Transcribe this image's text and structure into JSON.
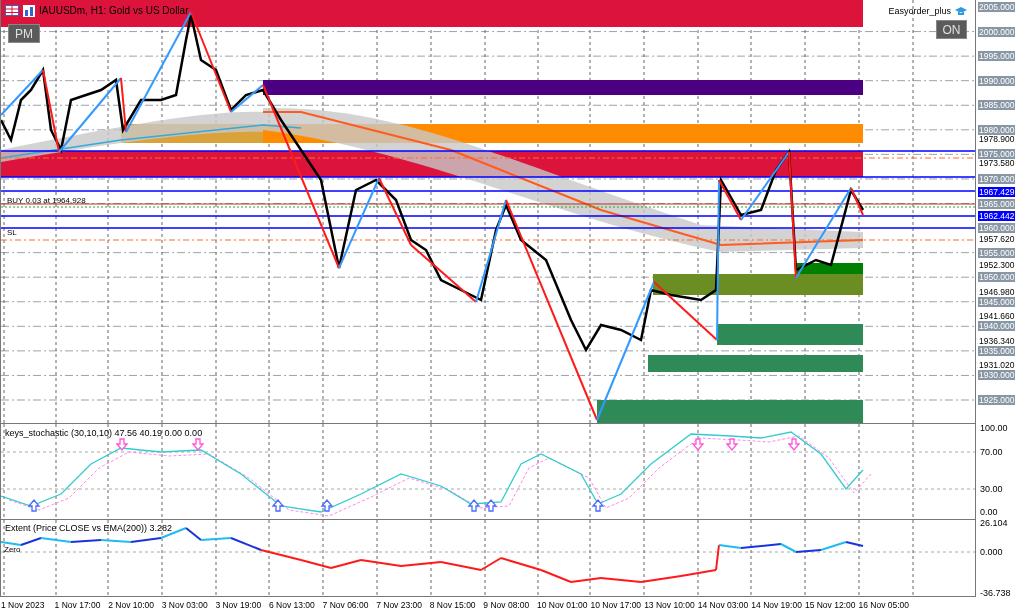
{
  "chart": {
    "title": "IAUUSDm, H1: Gold vs US Dollar",
    "left_button": "PM",
    "right_button": "ON",
    "expert": "Easyorder_plus",
    "trade_label": "BUY 0.03 at 1964.928",
    "sl_label": "SL"
  },
  "price_axis": [
    {
      "kind": "grid",
      "text": "2005.000"
    },
    {
      "kind": "grid",
      "text": "2000.000"
    },
    {
      "kind": "grid",
      "text": "1995.000"
    },
    {
      "kind": "grid",
      "text": "1990.000"
    },
    {
      "kind": "grid",
      "text": "1985.000"
    },
    {
      "kind": "grid",
      "text": "1980.000"
    },
    {
      "kind": "tick",
      "text": "1978.900"
    },
    {
      "kind": "grid",
      "text": "1975.000"
    },
    {
      "kind": "tick",
      "text": "1973.580"
    },
    {
      "kind": "grid",
      "text": "1970.000"
    },
    {
      "kind": "line",
      "text": "1967.429"
    },
    {
      "kind": "grid",
      "text": "1965.000"
    },
    {
      "kind": "line",
      "text": "1962.442"
    },
    {
      "kind": "grid",
      "text": "1960.000"
    },
    {
      "kind": "tick",
      "text": "1957.620"
    },
    {
      "kind": "grid",
      "text": "1955.000"
    },
    {
      "kind": "tick",
      "text": "1952.300"
    },
    {
      "kind": "grid",
      "text": "1950.000"
    },
    {
      "kind": "tick",
      "text": "1946.980"
    },
    {
      "kind": "grid",
      "text": "1945.000"
    },
    {
      "kind": "tick",
      "text": "1941.660"
    },
    {
      "kind": "grid",
      "text": "1940.000"
    },
    {
      "kind": "tick",
      "text": "1936.340"
    },
    {
      "kind": "grid",
      "text": "1935.000"
    },
    {
      "kind": "tick",
      "text": "1931.020"
    },
    {
      "kind": "grid",
      "text": "1930.000"
    },
    {
      "kind": "grid",
      "text": "1925.000"
    }
  ],
  "stochastic": {
    "label": "keys_stochastic (30,10,10) 47.56 40.19 0.00 0.00",
    "axis": [
      "100.00",
      "70.00",
      "30.00",
      "0.00"
    ]
  },
  "extent": {
    "label": "Extent (Price CLOSE vs EMA(200)) 3.282",
    "zero_label": "Zero",
    "axis": [
      "26.104",
      "0.000",
      "-36.738"
    ]
  },
  "time_axis": [
    "1 Nov 2023",
    "1 Nov 17:00",
    "2 Nov 10:00",
    "3 Nov 03:00",
    "3 Nov 19:00",
    "6 Nov 13:00",
    "7 Nov 06:00",
    "7 Nov 23:00",
    "8 Nov 15:00",
    "9 Nov 08:00",
    "10 Nov 01:00",
    "10 Nov 17:00",
    "13 Nov 10:00",
    "14 Nov 03:00",
    "14 Nov 19:00",
    "15 Nov 12:00",
    "16 Nov 05:00"
  ]
}
